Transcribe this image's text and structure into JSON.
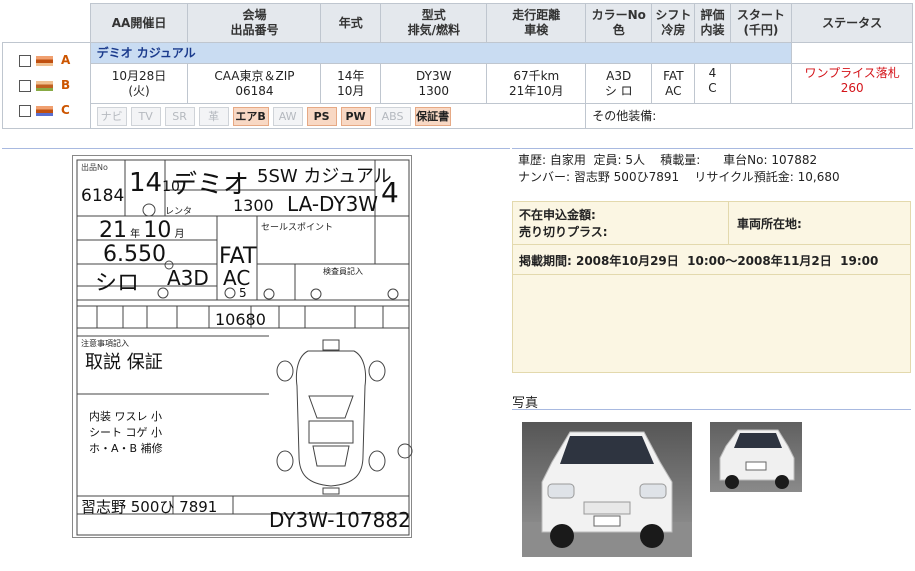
{
  "table": {
    "headers": {
      "aa_date": "AA開催日",
      "venue": [
        "会場",
        "出品番号"
      ],
      "year": "年式",
      "model": [
        "型式",
        "排気/燃料"
      ],
      "mileage": [
        "走行距離",
        "車検"
      ],
      "color": [
        "カラーNo",
        "色"
      ],
      "shift": [
        "シフト",
        "冷房"
      ],
      "grade": [
        "評価",
        "内装"
      ],
      "start": [
        "スタート",
        "(千円)"
      ],
      "status": "ステータス"
    },
    "select_labels": [
      "A",
      "B",
      "C"
    ],
    "car_name": "デミオ カジュアル",
    "date": [
      "10月28日",
      "(火)"
    ],
    "venue_value": [
      "CAA東京＆ZIP",
      "06184"
    ],
    "year_value": [
      "14年",
      "10月"
    ],
    "model_value": [
      "DY3W",
      "1300"
    ],
    "mileage_value": [
      "67千km",
      "21年10月"
    ],
    "color_value": [
      "A3D",
      "シ ロ"
    ],
    "shift_value": [
      "FAT",
      "AC"
    ],
    "grade_value": [
      "4",
      "C"
    ],
    "start_value": "",
    "status_value": [
      "ワンプライス落札",
      "260"
    ],
    "options": [
      {
        "label": "ナビ",
        "on": false
      },
      {
        "label": "TV",
        "on": false
      },
      {
        "label": "SR",
        "on": false
      },
      {
        "label": "革",
        "on": false
      },
      {
        "label": "エアB",
        "on": true
      },
      {
        "label": "AW",
        "on": false
      },
      {
        "label": "PS",
        "on": true
      },
      {
        "label": "PW",
        "on": true
      },
      {
        "label": "ABS",
        "on": false
      },
      {
        "label": "保証書",
        "on": true
      }
    ],
    "other_equipment": "その他装備:"
  },
  "info": {
    "line1": "車歴: 自家用  定員: 5人    積載量:      車台No: 107882",
    "line2": "ナンバー: 習志野 500ひ7891    リサイクル預託金: 10,680",
    "absent_label": "不在申込金額:",
    "plus_label": "売り切りプラス:",
    "location_label": "車両所在地:",
    "period": "掲載期間: 2008年10月29日  10:00～2008年11月2日  19:00"
  },
  "photos": {
    "title": "写真"
  },
  "sheet": {
    "lot_label": "出品No",
    "lot_no": "6184",
    "year_hand": "14",
    "month_hand": "10",
    "name_hand": "デミオ",
    "grade_hand": "5SW カジュアル",
    "score_hand": "4",
    "disp_hand": "1300",
    "model_hand": "LA-DY3W",
    "shaken_year": "21",
    "shaken_month": "10",
    "km_hand": "6.550",
    "color_hand": "シロ",
    "color_code": "A3D",
    "trans_hand": "FAT",
    "ac_hand": "AC",
    "seats_hand": "5",
    "recycle_hand": "10680",
    "notes1": "取説 保証",
    "notes2": [
      "内装 ワスレ 小",
      "シート コゲ 小",
      "ホ・A・B 補修"
    ],
    "plate_hand": "習志野 500ひ 7891",
    "chassis_hand": "DY3W-107882",
    "rental_label": "レンタ",
    "highlights_label": "セールスポイント",
    "inspection_label": "検査員記入",
    "notes_label": "注意事項記入"
  }
}
